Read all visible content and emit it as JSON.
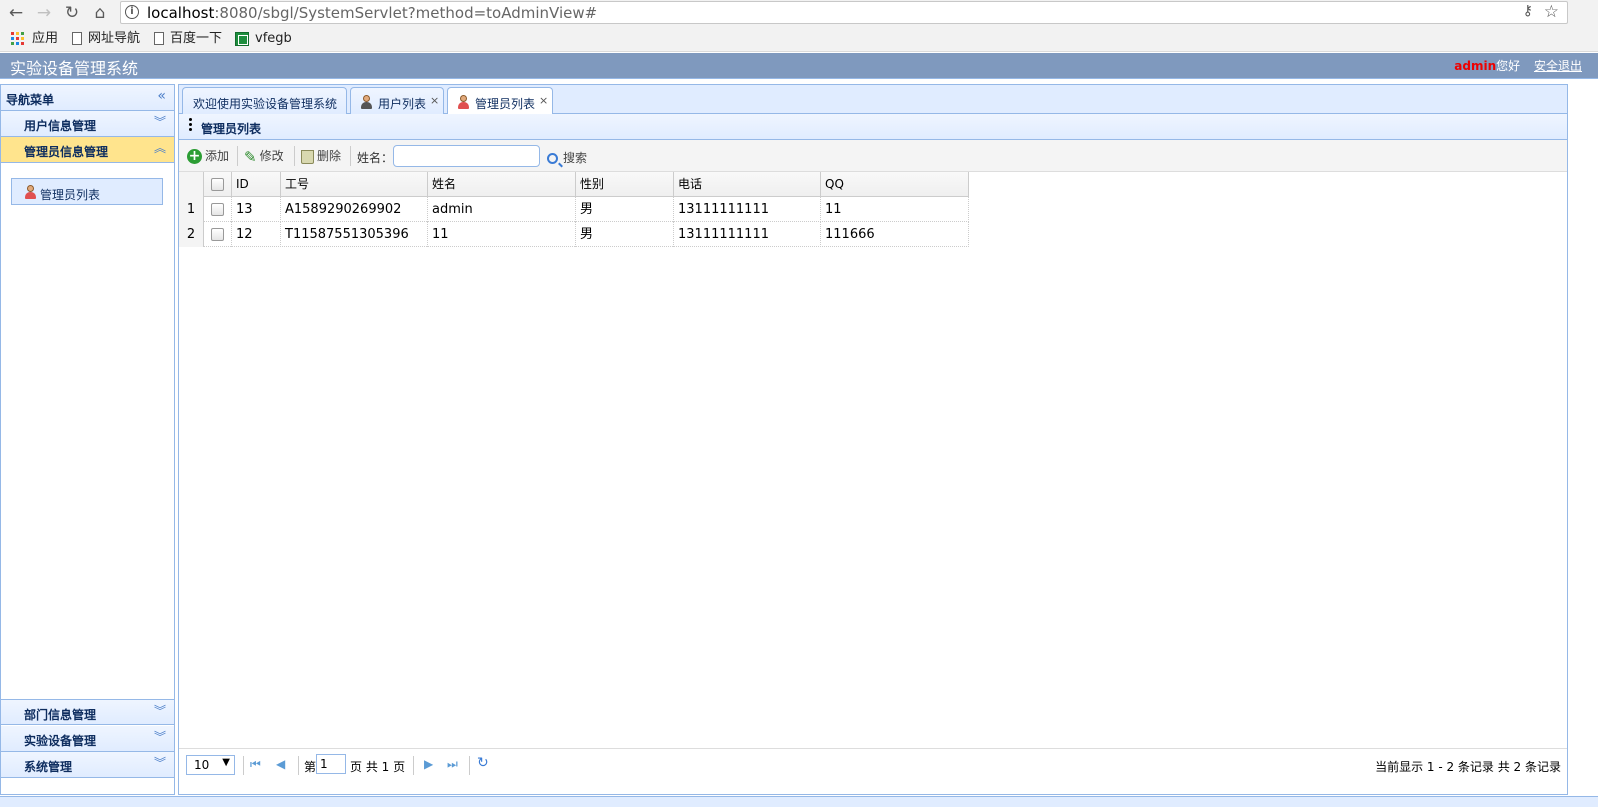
{
  "browser": {
    "url_host": "localhost",
    "url_rest": ":8080/sbgl/SystemServlet?method=toAdminView#",
    "bookmarks": [
      {
        "label": "应用",
        "icon": "apps-grid-icon"
      },
      {
        "label": "网址导航",
        "icon": "page-icon"
      },
      {
        "label": "百度一下",
        "icon": "page-icon"
      },
      {
        "label": "vfegb",
        "icon": "spreadsheet-icon"
      }
    ]
  },
  "header": {
    "title": "实验设备管理系统",
    "user": "admin",
    "greeting": "您好",
    "logout": "安全退出"
  },
  "sidebar": {
    "title": "导航菜单",
    "sections": [
      {
        "label": "用户信息管理",
        "expanded": false
      },
      {
        "label": "管理员信息管理",
        "expanded": true,
        "items": [
          {
            "label": "管理员列表",
            "icon": "person-icon"
          }
        ]
      },
      {
        "label": "部门信息管理",
        "expanded": false
      },
      {
        "label": "实验设备管理",
        "expanded": false
      },
      {
        "label": "系统管理",
        "expanded": false
      }
    ]
  },
  "tabs": [
    {
      "label": "欢迎使用实验设备管理系统",
      "closable": false,
      "active": false
    },
    {
      "label": "用户列表",
      "closable": true,
      "active": false,
      "icon": "user-icon"
    },
    {
      "label": "管理员列表",
      "closable": true,
      "active": true,
      "icon": "admin-icon"
    }
  ],
  "panel": {
    "title": "管理员列表",
    "toolbar": {
      "add": "添加",
      "edit": "修改",
      "delete": "删除",
      "name_label": "姓名：",
      "search_value": "",
      "search": "搜索"
    }
  },
  "grid": {
    "columns": [
      "ID",
      "工号",
      "姓名",
      "性别",
      "电话",
      "QQ"
    ],
    "rows": [
      {
        "num": "1",
        "id": "13",
        "sn": "A1589290269902",
        "name": "admin",
        "sex": "男",
        "phone": "13111111111",
        "qq": "11"
      },
      {
        "num": "2",
        "id": "12",
        "sn": "T11587551305396",
        "name": "11",
        "sex": "男",
        "phone": "13111111111",
        "qq": "111666"
      }
    ]
  },
  "pager": {
    "page_size": "10",
    "page_pre": "第",
    "page": "1",
    "page_post": "页 共 1 页",
    "info": "当前显示 1 - 2 条记录 共 2 条记录"
  },
  "colors": {
    "header_bg": "#7f99be",
    "border": "#95b8e7",
    "selected_section": "#ffe48d",
    "user_name": "#ee0000"
  }
}
